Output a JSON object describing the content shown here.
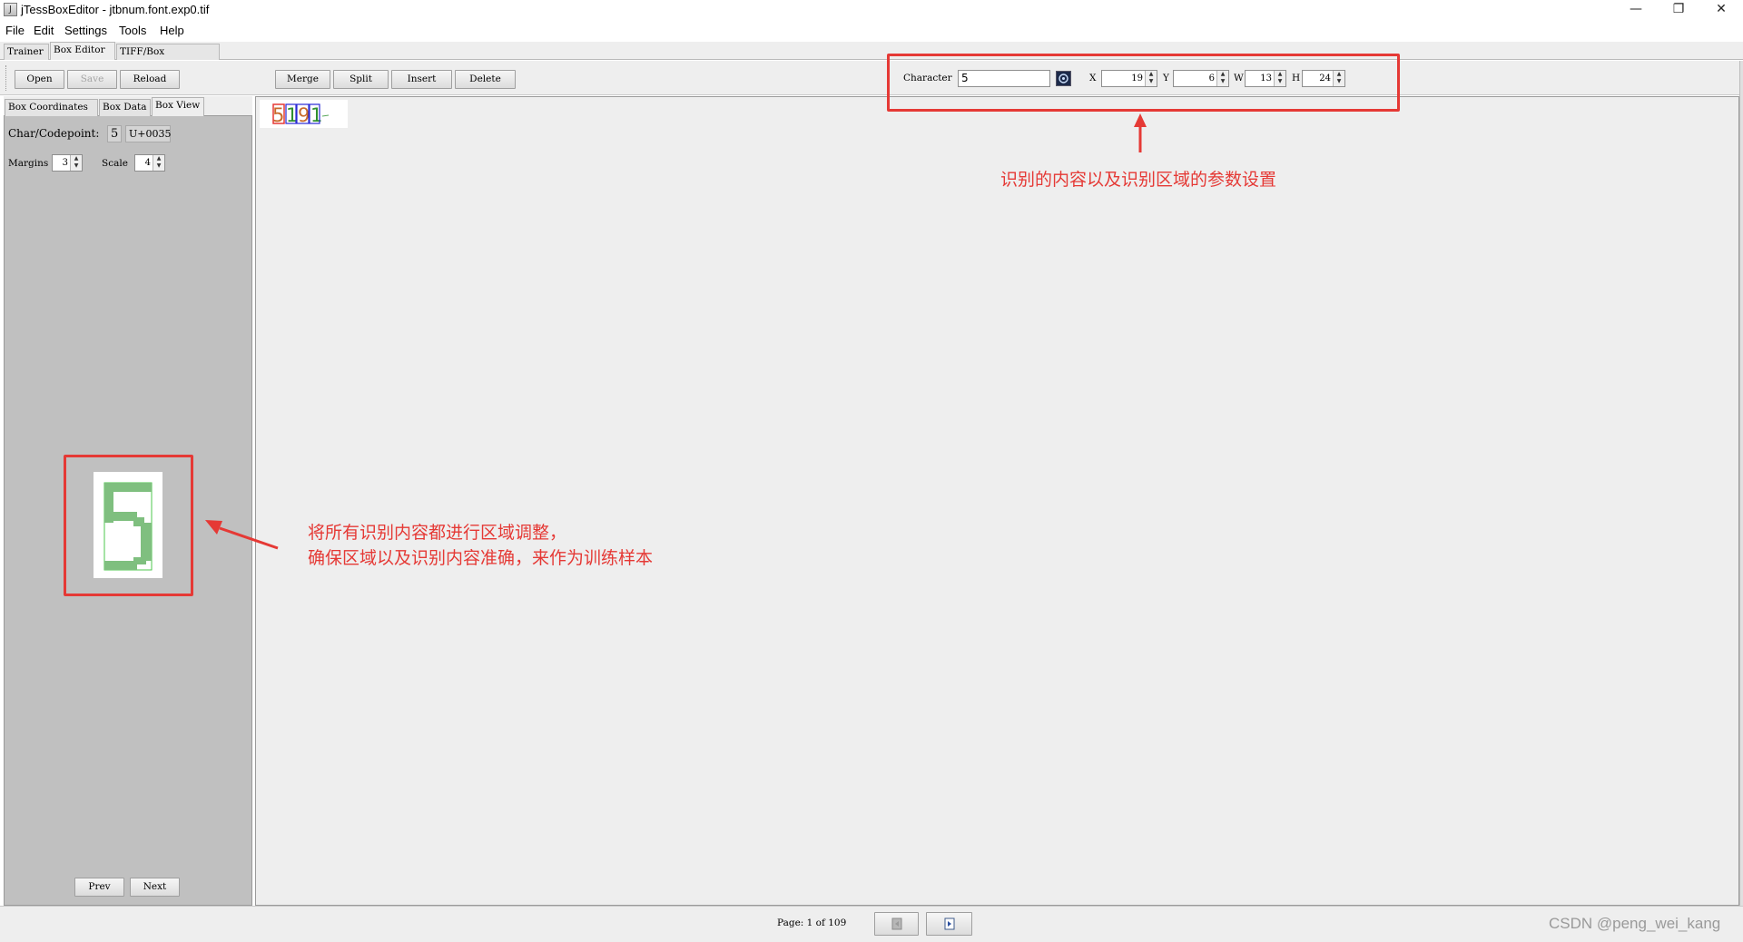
{
  "window": {
    "title": "jTessBoxEditor - jtbnum.font.exp0.tif",
    "minimize": "—",
    "restore": "❐",
    "close": "✕"
  },
  "menu": [
    "File",
    "Edit",
    "Settings",
    "Tools",
    "Help"
  ],
  "main_tabs": [
    "Trainer",
    "Box Editor",
    "TIFF/Box Generator"
  ],
  "active_main_tab": "Box Editor",
  "toolbar": {
    "open": "Open",
    "save": "Save",
    "reload": "Reload",
    "merge": "Merge",
    "split": "Split",
    "insert": "Insert",
    "delete": "Delete",
    "character_label": "Character",
    "character_value": "5",
    "x_label": "X",
    "x_value": "19",
    "y_label": "Y",
    "y_value": "6",
    "w_label": "W",
    "w_value": "13",
    "h_label": "H",
    "h_value": "24"
  },
  "left_panel": {
    "tabs": [
      "Box Coordinates",
      "Box Data",
      "Box View"
    ],
    "active_tab": "Box View",
    "codepoint_label": "Char/Codepoint:",
    "char_value": "5",
    "codepoint_value": "U+0035",
    "margins_label": "Margins",
    "margins_value": "3",
    "scale_label": "Scale",
    "scale_value": "4",
    "prev": "Prev",
    "next": "Next"
  },
  "status": {
    "page_text": "Page: 1 of 109",
    "watermark": "CSDN @peng_wei_kang"
  },
  "annotations": {
    "top": "识别的内容以及识别区域的参数设置",
    "left_line1": "将所有识别内容都进行区域调整，",
    "left_line2": "确保区域以及识别内容准确，来作为训练样本"
  },
  "colors": {
    "annotation_red": "#e53935",
    "box_selected": "#e53935",
    "box_normal": "#2a2ad6",
    "glyph_fill": "#7fbf7f"
  },
  "icons": [
    "app-icon",
    "char-picker-icon",
    "prev-page-icon",
    "next-page-icon",
    "spinner-arrows-icon"
  ]
}
